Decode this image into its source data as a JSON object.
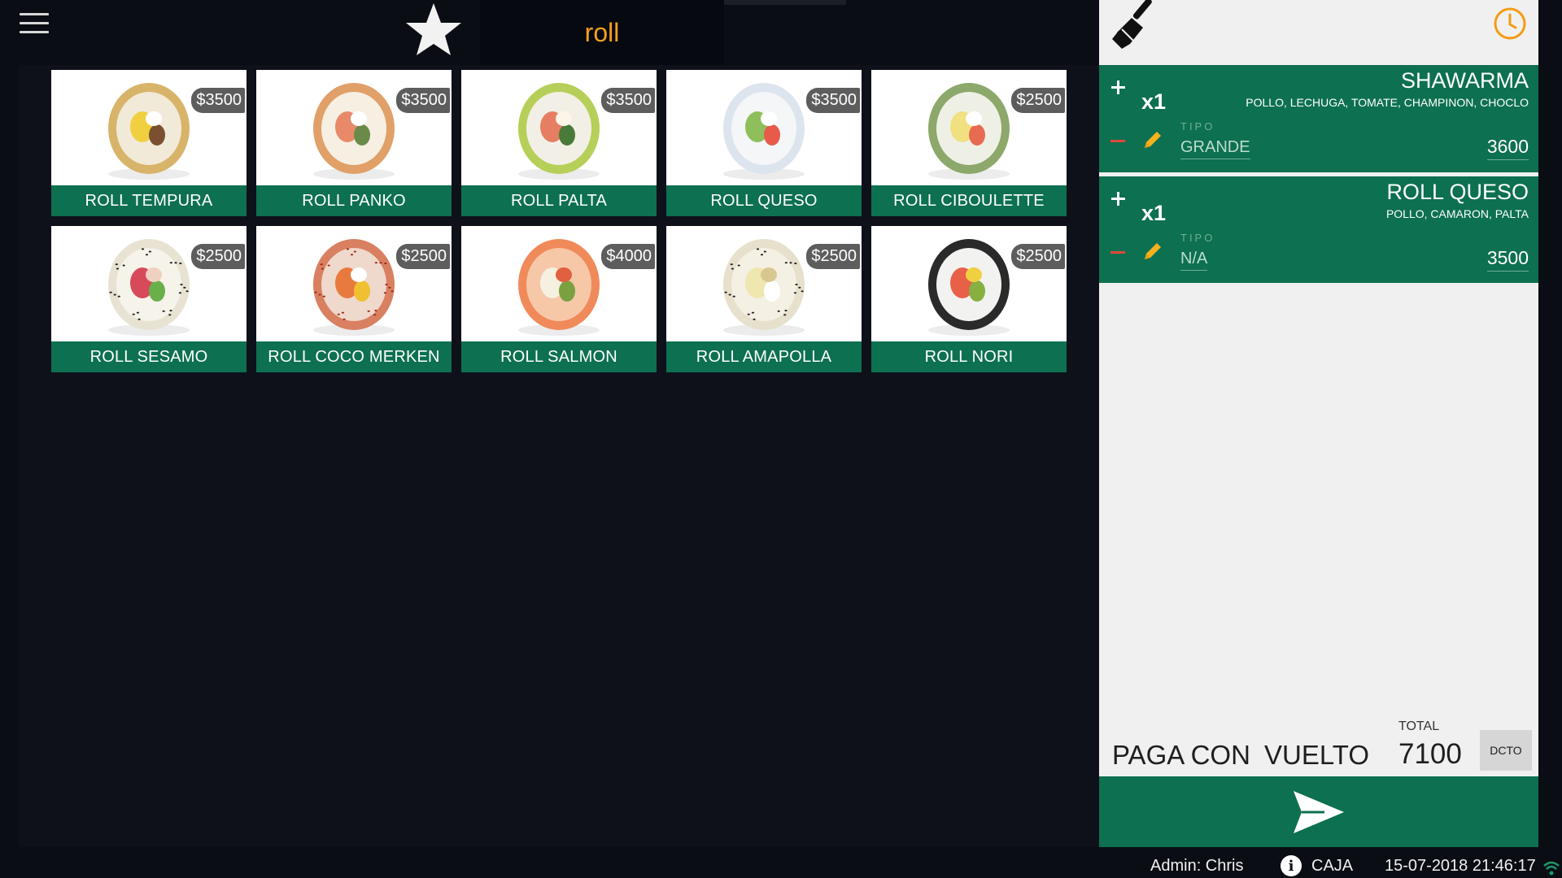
{
  "search": {
    "value": "roll"
  },
  "products": [
    {
      "name": "ROLL TEMPURA",
      "price": "$3500",
      "variant": "tempura"
    },
    {
      "name": "ROLL PANKO",
      "price": "$3500",
      "variant": "panko"
    },
    {
      "name": "ROLL PALTA",
      "price": "$3500",
      "variant": "palta"
    },
    {
      "name": "ROLL QUESO",
      "price": "$3500",
      "variant": "queso"
    },
    {
      "name": "ROLL CIBOULETTE",
      "price": "$2500",
      "variant": "ciboulette"
    },
    {
      "name": "ROLL SESAMO",
      "price": "$2500",
      "variant": "sesamo"
    },
    {
      "name": "ROLL COCO MERKEN",
      "price": "$2500",
      "variant": "coco"
    },
    {
      "name": "ROLL SALMON",
      "price": "$4000",
      "variant": "salmon"
    },
    {
      "name": "ROLL AMAPOLLA",
      "price": "$2500",
      "variant": "amapolla"
    },
    {
      "name": "ROLL NORI",
      "price": "$2500",
      "variant": "nori"
    }
  ],
  "order": {
    "items": [
      {
        "qty": "x1",
        "name": "SHAWARMA",
        "description": "POLLO, LECHUGA, TOMATE, CHAMPINON, CHOCLO",
        "tipo_label": "TIPO",
        "tipo": "GRANDE",
        "price": "3600"
      },
      {
        "qty": "x1",
        "name": "ROLL QUESO",
        "description": "POLLO, CAMARON, PALTA",
        "tipo_label": "TIPO",
        "tipo": "N/A",
        "price": "3500"
      }
    ],
    "paga_con": "PAGA CON",
    "vuelto": "VUELTO",
    "total_label": "TOTAL",
    "total": "7100",
    "dcto": "DCTO"
  },
  "status": {
    "admin": "Admin: Chris",
    "caja": "CAJA",
    "datetime": "15-07-2018 21:46:17"
  },
  "colors": {
    "accent_green": "#0d7050",
    "search_orange": "#f5a11c",
    "clock_orange": "#f39c12"
  }
}
